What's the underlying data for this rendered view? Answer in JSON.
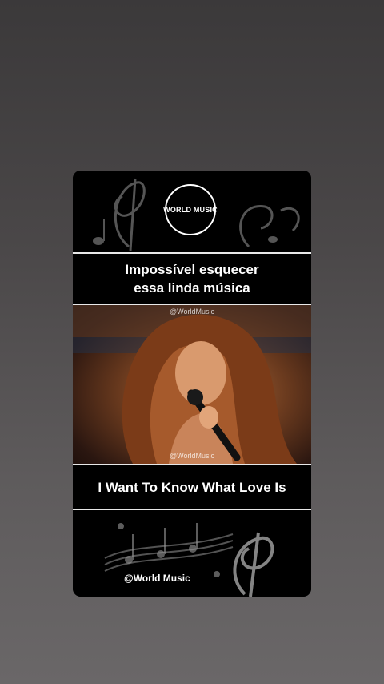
{
  "logo": {
    "text": "WORLD MUSIC"
  },
  "caption": {
    "line1": "Impossível esquecer",
    "line2": "essa linda música"
  },
  "video": {
    "watermark_top": "@WorldMusic",
    "watermark_bottom": "@WorldMusic"
  },
  "song": {
    "title": "I Want To Know What Love Is"
  },
  "footer": {
    "handle": "@World Music"
  }
}
